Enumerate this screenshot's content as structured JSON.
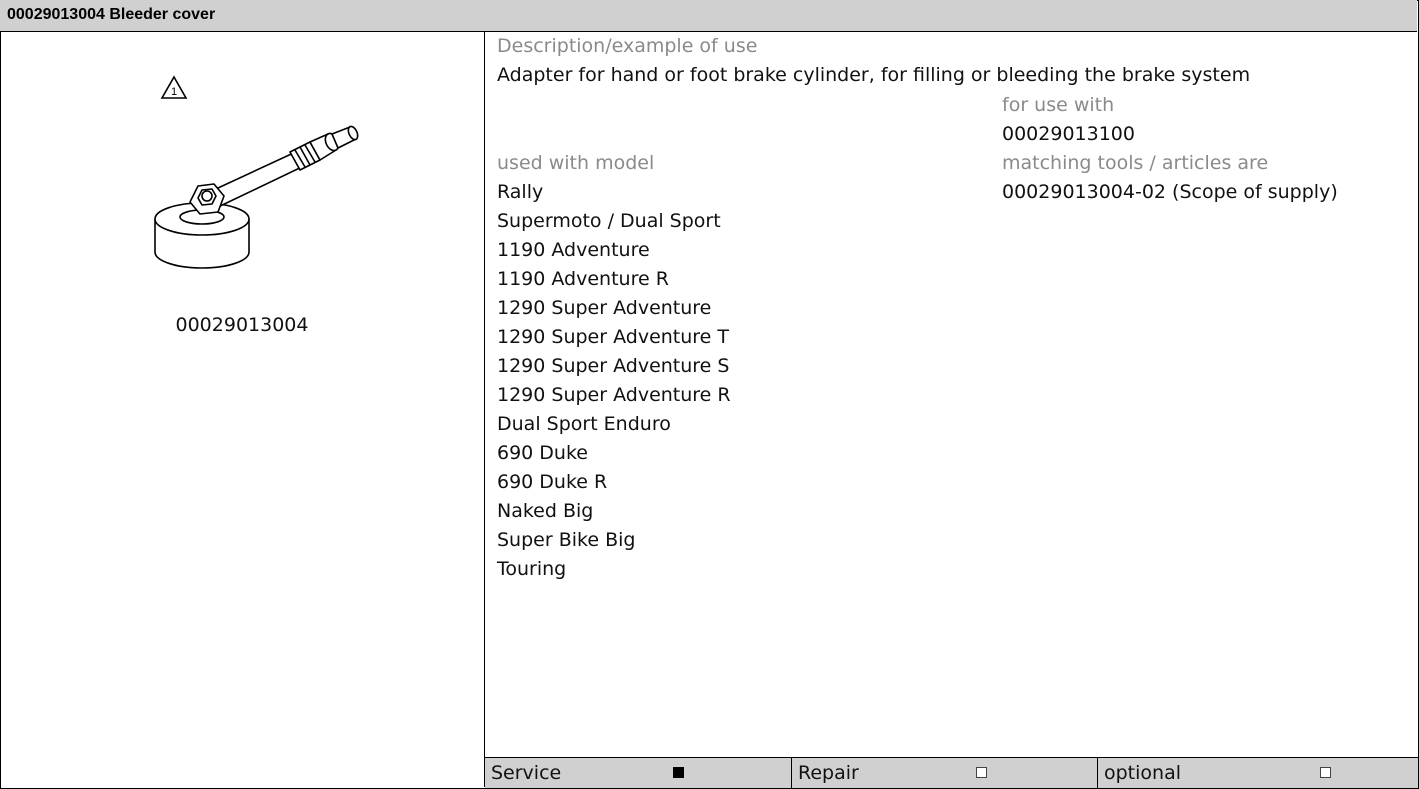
{
  "header": {
    "title": "00029013004 Bleeder cover"
  },
  "tool": {
    "warning_icon_number": "1",
    "part_number": "00029013004"
  },
  "description": {
    "label": "Description/example of use",
    "text": "Adapter for hand or foot brake cylinder, for filling or bleeding the brake system"
  },
  "for_use_with": {
    "label": "for use with",
    "value": "00029013100"
  },
  "models": {
    "label": "used with model",
    "items": [
      "Rally",
      "Supermoto / Dual Sport",
      "1190 Adventure",
      "1190 Adventure R",
      "1290 Super Adventure",
      "1290 Super Adventure T",
      "1290 Super Adventure S",
      "1290 Super Adventure R",
      "Dual Sport Enduro",
      "690 Duke",
      "690 Duke R",
      "Naked Big",
      "Super Bike Big",
      "Touring"
    ]
  },
  "matching": {
    "label": "matching tools / articles are",
    "value": "00029013004-02 (Scope of supply)"
  },
  "footer": {
    "service_label": "Service",
    "service_checked": true,
    "repair_label": "Repair",
    "repair_checked": false,
    "optional_label": "optional",
    "optional_checked": false
  }
}
